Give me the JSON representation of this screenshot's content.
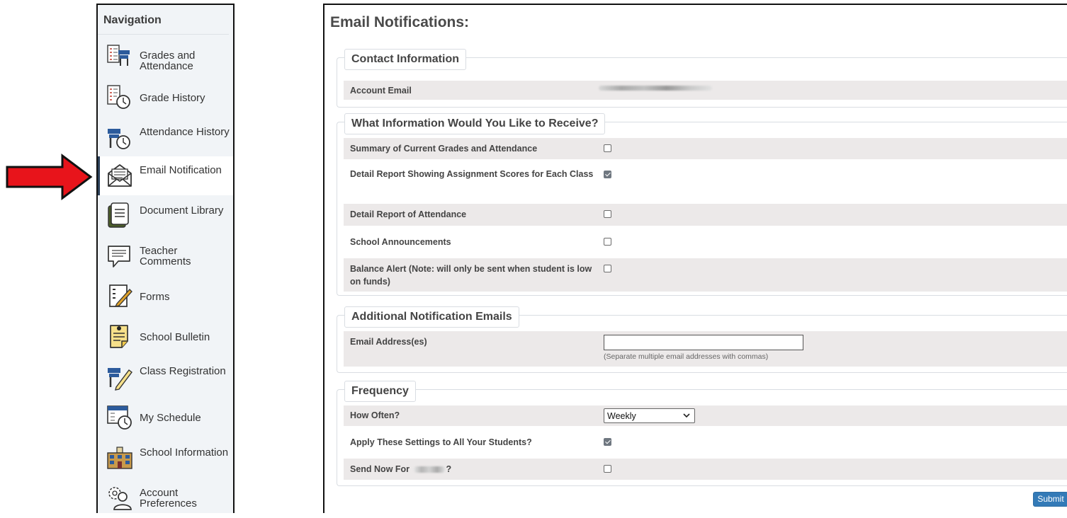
{
  "navigation": {
    "title": "Navigation",
    "items": [
      {
        "label": "Grades and Attendance",
        "icon": "grades-attendance-icon"
      },
      {
        "label": "Grade History",
        "icon": "grade-history-icon"
      },
      {
        "label": "Attendance History",
        "icon": "attendance-history-icon"
      },
      {
        "label": "Email Notification",
        "icon": "email-notification-icon",
        "active": true
      },
      {
        "label": "Document Library",
        "icon": "document-library-icon"
      },
      {
        "label": "Teacher Comments",
        "icon": "teacher-comments-icon"
      },
      {
        "label": "Forms",
        "icon": "forms-icon"
      },
      {
        "label": "School Bulletin",
        "icon": "school-bulletin-icon"
      },
      {
        "label": "Class Registration",
        "icon": "class-registration-icon"
      },
      {
        "label": "My Schedule",
        "icon": "my-schedule-icon"
      },
      {
        "label": "School Information",
        "icon": "school-information-icon"
      },
      {
        "label": "Account Preferences",
        "icon": "account-preferences-icon"
      }
    ]
  },
  "main": {
    "title": "Email Notifications:",
    "contact": {
      "legend": "Contact Information",
      "account_email_label": "Account Email"
    },
    "receive": {
      "legend": "What Information Would You Like to Receive?",
      "options": [
        {
          "label": "Summary of Current Grades and Attendance",
          "checked": false
        },
        {
          "label": "Detail Report Showing Assignment Scores for Each Class",
          "checked": true
        },
        {
          "label": "Detail Report of Attendance",
          "checked": false
        },
        {
          "label": "School Announcements",
          "checked": false
        },
        {
          "label": "Balance Alert (Note: will only be sent when student is low on funds)",
          "checked": false
        }
      ]
    },
    "additional": {
      "legend": "Additional Notification Emails",
      "email_label": "Email Address(es)",
      "email_value": "",
      "help_text": "(Separate multiple email addresses with commas)"
    },
    "frequency": {
      "legend": "Frequency",
      "how_often_label": "How Often?",
      "how_often_value": "Weekly",
      "apply_all_label": "Apply These Settings to All Your Students?",
      "apply_all_checked": true,
      "send_now_prefix": "Send Now For",
      "send_now_suffix": "?",
      "send_now_checked": false
    },
    "submit_label": "Submit"
  },
  "colors": {
    "arrow": "#e8141b",
    "nav_background": "#f1f4f7",
    "row_shade": "#ece9e9",
    "submit_button": "#337ab7"
  }
}
